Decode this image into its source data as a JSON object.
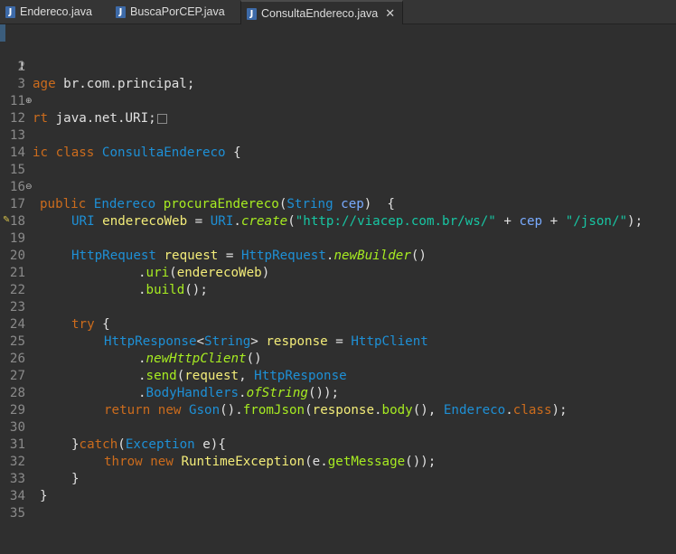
{
  "tabs": [
    {
      "label": "Endereco.java",
      "icon": "java-file-icon",
      "active": false
    },
    {
      "label": "BuscaPorCEP.java",
      "icon": "java-file-icon",
      "active": false
    },
    {
      "label": "ConsultaEndereco.java",
      "icon": "java-file-icon",
      "active": true,
      "close": "✕"
    }
  ],
  "editor": {
    "lines": [
      {
        "n": "1"
      },
      {
        "n": "2"
      },
      {
        "n": "3"
      },
      {
        "n": "11"
      },
      {
        "n": "12"
      },
      {
        "n": "13"
      },
      {
        "n": "14"
      },
      {
        "n": "15"
      },
      {
        "n": "16"
      },
      {
        "n": "17"
      },
      {
        "n": "18"
      },
      {
        "n": "19"
      },
      {
        "n": "20"
      },
      {
        "n": "21"
      },
      {
        "n": "22"
      },
      {
        "n": "23"
      },
      {
        "n": "24"
      },
      {
        "n": "25"
      },
      {
        "n": "26"
      },
      {
        "n": "27"
      },
      {
        "n": "28"
      },
      {
        "n": "29"
      },
      {
        "n": "30"
      },
      {
        "n": "31"
      },
      {
        "n": "32"
      },
      {
        "n": "33"
      },
      {
        "n": "34"
      },
      {
        "n": "35"
      }
    ],
    "tokens": {
      "l1": [
        "age",
        " br.com.principal;"
      ],
      "l3": [
        "rt",
        " java.net.URI;"
      ],
      "l13": [
        "ic",
        " ",
        "class",
        " ",
        "ConsultaEndereco",
        " {"
      ],
      "l15": [
        "public",
        " ",
        "Endereco",
        " ",
        "procuraEndereco",
        "(",
        "String",
        " ",
        "cep",
        ")  {"
      ],
      "l17": [
        "URI",
        " ",
        "enderecoWeb",
        " = ",
        "URI",
        ".",
        "create",
        "(",
        "\"http://viacep.com.br/ws/\"",
        " + ",
        "cep",
        " + ",
        "\"/json/\"",
        ");"
      ],
      "l19": [
        "HttpRequest",
        " ",
        "request",
        " = ",
        "HttpRequest",
        ".",
        "newBuilder",
        "()"
      ],
      "l20": [
        ".",
        "uri",
        "(",
        "enderecoWeb",
        ")"
      ],
      "l21": [
        ".",
        "build",
        "();"
      ],
      "l23": [
        "try",
        " {"
      ],
      "l24": [
        "HttpResponse",
        "<",
        "String",
        "> ",
        "response",
        " = ",
        "HttpClient"
      ],
      "l25": [
        ".",
        "newHttpClient",
        "()"
      ],
      "l26": [
        ".",
        "send",
        "(",
        "request",
        ", ",
        "HttpResponse"
      ],
      "l27": [
        ".",
        "BodyHandlers",
        ".",
        "ofString",
        "());"
      ],
      "l28": [
        "return",
        " ",
        "new",
        " ",
        "Gson",
        "().",
        "fromJson",
        "(",
        "response",
        ".",
        "body",
        "(), ",
        "Endereco",
        ".",
        "class",
        ");"
      ],
      "l30": [
        "}",
        "catch",
        "(",
        "Exception",
        " ",
        "e",
        "){"
      ],
      "l31": [
        "throw",
        " ",
        "new",
        " ",
        "RuntimeException",
        "(",
        "e",
        ".",
        "getMessage",
        "());"
      ],
      "l32": [
        "}"
      ],
      "l33": [
        "}"
      ]
    }
  }
}
